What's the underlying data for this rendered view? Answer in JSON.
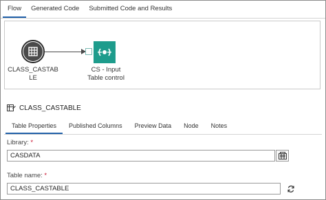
{
  "top_tabs": [
    "Flow",
    "Generated Code",
    "Submitted Code and Results"
  ],
  "canvas": {
    "table_node_label": "CLASS_CASTABLE",
    "cs_node_label_line1": "CS - Input",
    "cs_node_label_line2": "Table control"
  },
  "section": {
    "title": "CLASS_CASTABLE"
  },
  "sub_tabs": [
    "Table Properties",
    "Published Columns",
    "Preview Data",
    "Node",
    "Notes"
  ],
  "form": {
    "library_label": "Library:",
    "library_value": "CASDATA",
    "table_name_label": "Table name:",
    "table_name_value": "CLASS_CASTABLE",
    "required_mark": "*"
  },
  "colors": {
    "accent": "#1f5fa8",
    "cs_node": "#1e9c8c",
    "required": "#c8102e"
  }
}
